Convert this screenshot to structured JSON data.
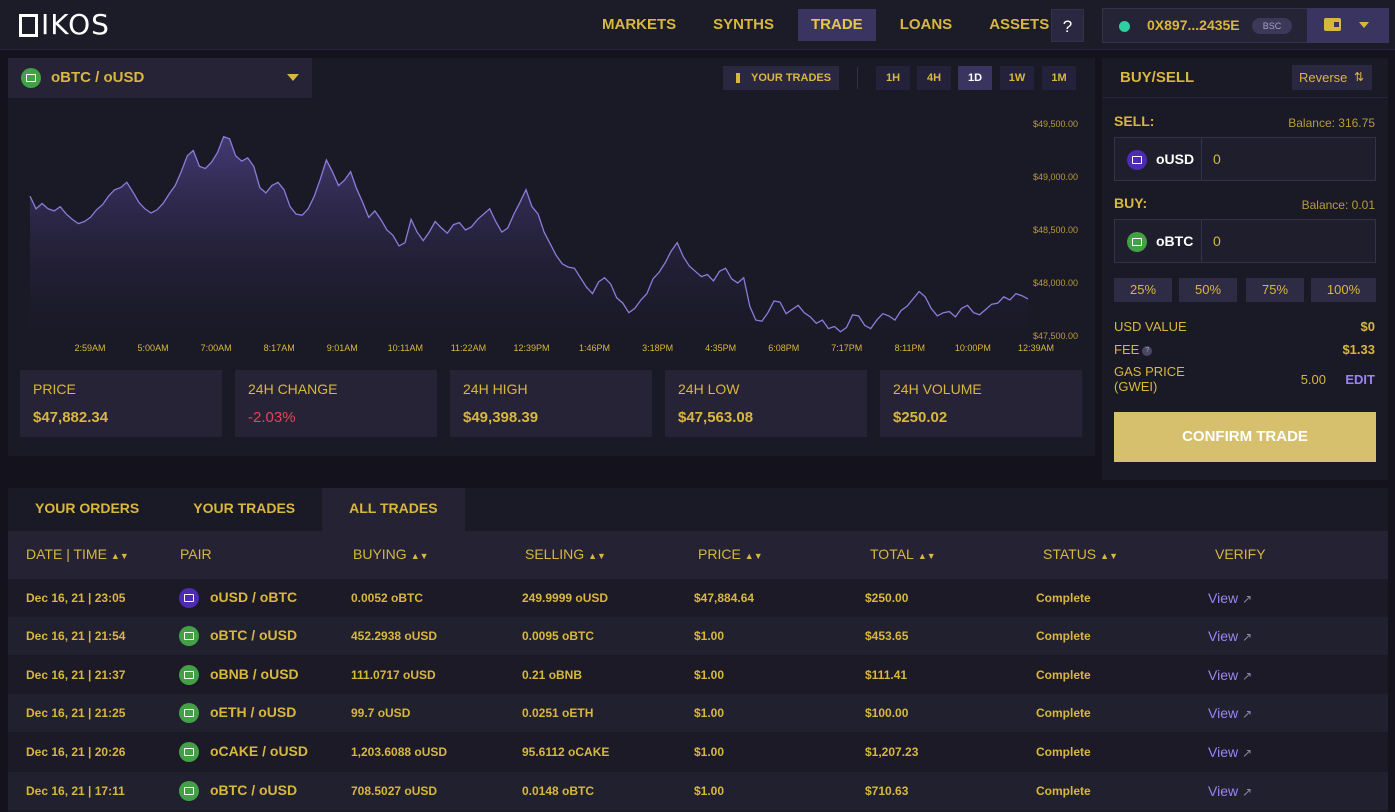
{
  "header": {
    "logo": "IKOS",
    "nav": [
      "MARKETS",
      "SYNTHS",
      "TRADE",
      "LOANS",
      "ASSETS"
    ],
    "active_nav": "TRADE",
    "help": "?",
    "wallet_address": "0X897...2435E",
    "network": "BSC"
  },
  "chart_panel": {
    "pair": "oBTC / oUSD",
    "your_trades": "YOUR TRADES",
    "timeframes": [
      "1H",
      "4H",
      "1D",
      "1W",
      "1M"
    ],
    "active_timeframe": "1D",
    "stats": [
      {
        "label": "PRICE",
        "value": "$47,882.34"
      },
      {
        "label": "24H CHANGE",
        "value": "-2.03%"
      },
      {
        "label": "24H HIGH",
        "value": "$49,398.39"
      },
      {
        "label": "24H LOW",
        "value": "$47,563.08"
      },
      {
        "label": "24H VOLUME",
        "value": "$250.02"
      }
    ]
  },
  "chart_data": {
    "type": "area",
    "x_ticks": [
      "2:59AM",
      "5:00AM",
      "7:00AM",
      "8:17AM",
      "9:01AM",
      "10:11AM",
      "11:22AM",
      "12:39PM",
      "1:46PM",
      "3:18PM",
      "4:35PM",
      "6:08PM",
      "7:17PM",
      "8:11PM",
      "10:00PM",
      "12:39AM"
    ],
    "y_ticks": [
      "$49,500.00",
      "$49,000.00",
      "$48,500.00",
      "$48,000.00",
      "$47,500.00"
    ],
    "ylim": [
      47500,
      49500
    ],
    "series": [
      {
        "values": [
          48820,
          48700,
          48750,
          48700,
          48680,
          48720,
          48650,
          48600,
          48560,
          48580,
          48620,
          48690,
          48740,
          48820,
          48880,
          48900,
          48950,
          48860,
          48760,
          48700,
          48660,
          48690,
          48750,
          48840,
          48920,
          49050,
          49200,
          49250,
          49100,
          49080,
          49140,
          49230,
          49380,
          49360,
          49200,
          49150,
          49180,
          49100,
          48900,
          48850,
          48920,
          48950,
          48880,
          48720,
          48650,
          48640,
          48700,
          48820,
          48980,
          49160,
          49050,
          48920,
          48970,
          49050,
          48890,
          48760,
          48620,
          48680,
          48600,
          48500,
          48450,
          48350,
          48380,
          48600,
          48480,
          48400,
          48480,
          48580,
          48520,
          48470,
          48550,
          48570,
          48500,
          48530,
          48600,
          48650,
          48700,
          48580,
          48480,
          48520,
          48650,
          48760,
          48880,
          48720,
          48650,
          48480,
          48370,
          48260,
          48180,
          48150,
          48140,
          48050,
          47960,
          47900,
          48010,
          48050,
          47990,
          47860,
          47810,
          47720,
          47760,
          47840,
          47900,
          48040,
          48100,
          48190,
          48300,
          48380,
          48250,
          48160,
          48110,
          48060,
          48080,
          48020,
          48110,
          48140,
          48040,
          48000,
          48050,
          47780,
          47650,
          47640,
          47720,
          47830,
          47820,
          47710,
          47750,
          47790,
          47720,
          47680,
          47620,
          47650,
          47570,
          47590,
          47540,
          47580,
          47700,
          47690,
          47600,
          47570,
          47650,
          47710,
          47690,
          47650,
          47740,
          47780,
          47850,
          47920,
          47870,
          47760,
          47690,
          47720,
          47730,
          47680,
          47760,
          47790,
          47720,
          47700,
          47750,
          47800,
          47810,
          47870,
          47840,
          47900,
          47880,
          47850
        ]
      }
    ],
    "grid": false
  },
  "trade_panel": {
    "title": "BUY/SELL",
    "reverse": "Reverse",
    "sell_label": "SELL:",
    "sell_balance": "Balance: 316.75",
    "sell_token": "oUSD",
    "sell_amount": "0",
    "buy_label": "BUY:",
    "buy_balance": "Balance: 0.01",
    "buy_token": "oBTC",
    "buy_amount": "0",
    "percents": [
      "25%",
      "50%",
      "75%",
      "100%"
    ],
    "usd_value_label": "USD VALUE",
    "usd_value": "$0",
    "fee_label": "FEE",
    "fee": "$1.33",
    "gas_label_1": "GAS PRICE",
    "gas_label_2": "(GWEI)",
    "gas_value": "5.00",
    "edit": "EDIT",
    "confirm": "CONFIRM TRADE"
  },
  "orders": {
    "tabs": [
      "YOUR ORDERS",
      "YOUR TRADES",
      "ALL TRADES"
    ],
    "active_tab": "ALL TRADES",
    "columns": [
      "DATE | TIME",
      "PAIR",
      "BUYING",
      "SELLING",
      "PRICE",
      "TOTAL",
      "STATUS",
      "VERIFY"
    ],
    "sortable": [
      true,
      false,
      true,
      true,
      true,
      true,
      true,
      false
    ],
    "rows": [
      {
        "date": "Dec 16, 21 | 23:05",
        "pair": "oUSD / oBTC",
        "coin": "purple",
        "buying": "0.0052 oBTC",
        "selling": "249.9999 oUSD",
        "price": "$47,884.64",
        "total": "$250.00",
        "status": "Complete",
        "verify": "View"
      },
      {
        "date": "Dec 16, 21 | 21:54",
        "pair": "oBTC / oUSD",
        "coin": "green",
        "buying": "452.2938 oUSD",
        "selling": "0.0095 oBTC",
        "price": "$1.00",
        "total": "$453.65",
        "status": "Complete",
        "verify": "View"
      },
      {
        "date": "Dec 16, 21 | 21:37",
        "pair": "oBNB / oUSD",
        "coin": "green",
        "buying": "111.0717 oUSD",
        "selling": "0.21 oBNB",
        "price": "$1.00",
        "total": "$111.41",
        "status": "Complete",
        "verify": "View"
      },
      {
        "date": "Dec 16, 21 | 21:25",
        "pair": "oETH / oUSD",
        "coin": "green",
        "buying": "99.7 oUSD",
        "selling": "0.0251 oETH",
        "price": "$1.00",
        "total": "$100.00",
        "status": "Complete",
        "verify": "View"
      },
      {
        "date": "Dec 16, 21 | 20:26",
        "pair": "oCAKE / oUSD",
        "coin": "green",
        "buying": "1,203.6088 oUSD",
        "selling": "95.6112 oCAKE",
        "price": "$1.00",
        "total": "$1,207.23",
        "status": "Complete",
        "verify": "View"
      },
      {
        "date": "Dec 16, 21 | 17:11",
        "pair": "oBTC / oUSD",
        "coin": "green",
        "buying": "708.5027 oUSD",
        "selling": "0.0148 oBTC",
        "price": "$1.00",
        "total": "$710.63",
        "status": "Complete",
        "verify": "View"
      }
    ]
  },
  "colors": {
    "gold": "#d8b73e",
    "purple_accent": "#9b84f5",
    "negative": "#e4455c",
    "line": "#8c7bdc"
  }
}
